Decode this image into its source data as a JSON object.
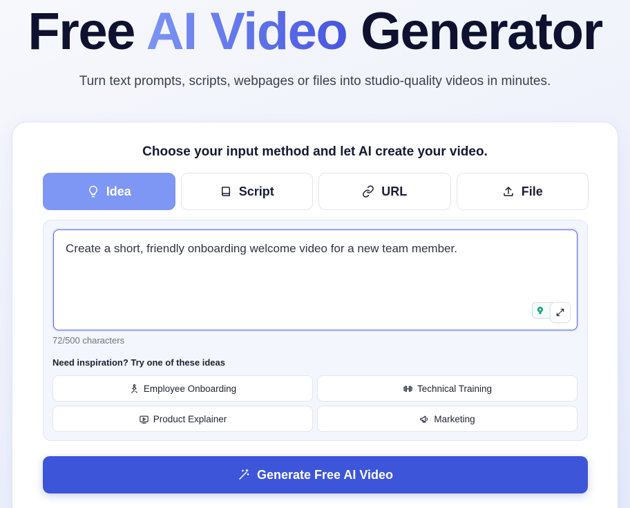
{
  "hero": {
    "title_part1": "Free ",
    "title_accent": "AI Video",
    "title_part2": " Generator",
    "subtitle": "Turn text prompts, scripts, webpages or files into studio-quality videos in minutes."
  },
  "card": {
    "heading": "Choose your input method and let AI create your video."
  },
  "tabs": [
    {
      "label": "Idea",
      "icon": "lightbulb-icon",
      "active": true
    },
    {
      "label": "Script",
      "icon": "book-icon",
      "active": false
    },
    {
      "label": "URL",
      "icon": "link-icon",
      "active": false
    },
    {
      "label": "File",
      "icon": "upload-icon",
      "active": false
    }
  ],
  "prompt": {
    "value": "Create a short, friendly onboarding welcome video for a new team member.",
    "char_count": "72/500 characters"
  },
  "inspiration": {
    "label": "Need inspiration? Try one of these ideas",
    "ideas": [
      {
        "label": "Employee Onboarding",
        "icon": "person-rocket-icon"
      },
      {
        "label": "Technical Training",
        "icon": "dumbbell-icon"
      },
      {
        "label": "Product Explainer",
        "icon": "video-play-icon"
      },
      {
        "label": "Marketing",
        "icon": "megaphone-icon"
      }
    ]
  },
  "generate": {
    "label": "Generate Free AI Video",
    "icon": "magic-wand-icon"
  },
  "colors": {
    "accent": "#3d55d8",
    "tab_active": "#7e96f4",
    "title_dark": "#0e1230"
  }
}
